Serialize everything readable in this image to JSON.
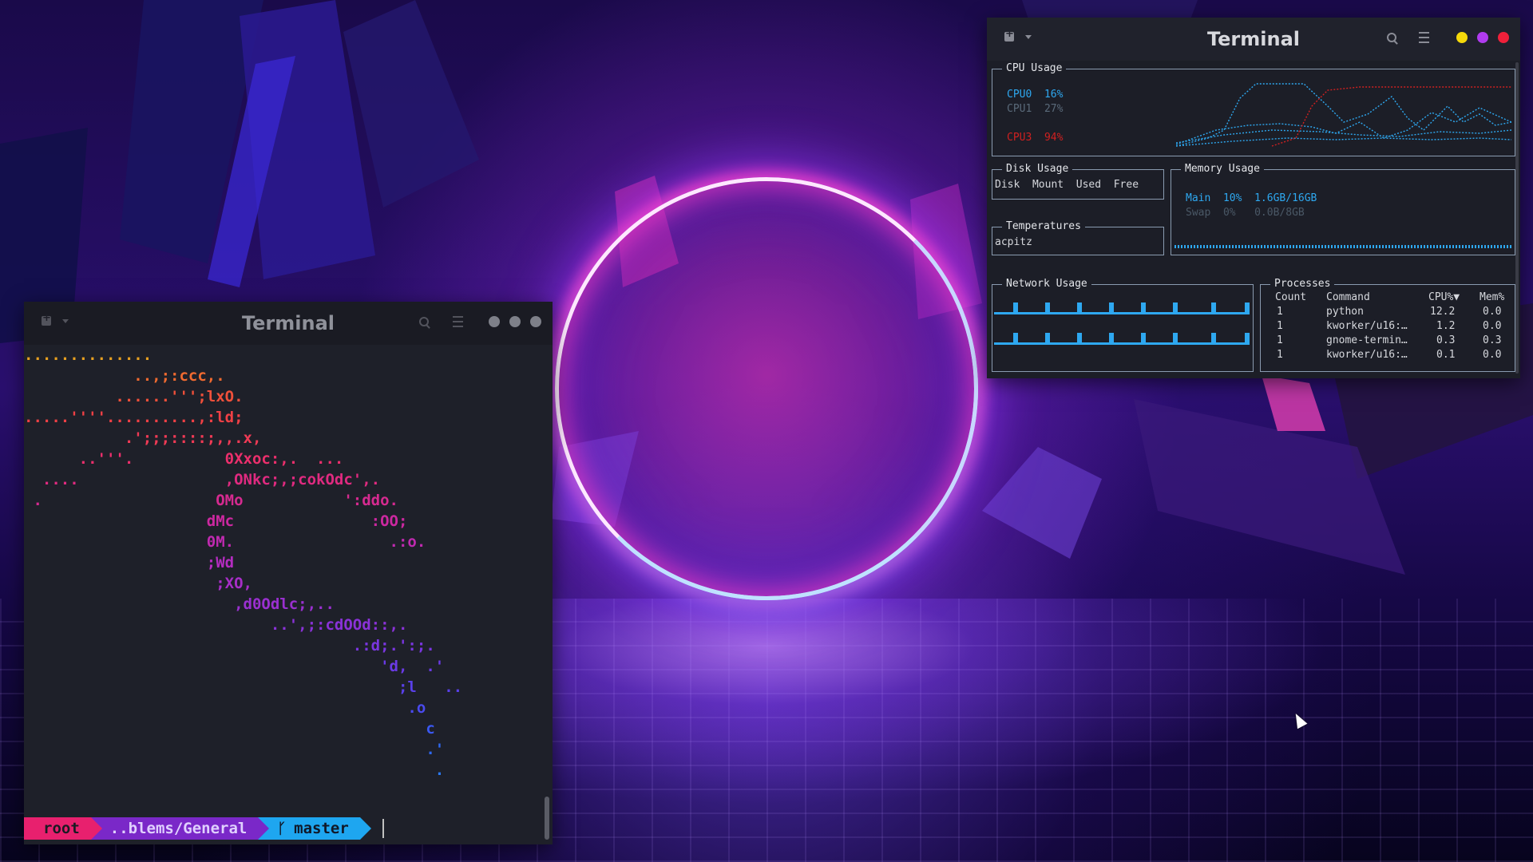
{
  "colors": {
    "accent_blue": "#2ea8f0",
    "alert_red": "#d02020",
    "prompt_pink": "#e8206e",
    "prompt_purple": "#7a28c8",
    "dot_yellow": "#f5d90a",
    "dot_purple": "#b03bf0",
    "dot_red": "#f0203a"
  },
  "left_terminal": {
    "title": "Terminal",
    "art_lines": [
      {
        "text": "..............",
        "color": "#e8a020"
      },
      {
        "text": "            ..,;:ccc,.",
        "color": "#f06a30"
      },
      {
        "text": "          ......''';lxO.",
        "color": "#f0503a"
      },
      {
        "text": ".....''''..........,:ld;",
        "color": "#f04045"
      },
      {
        "text": "           .';;;::::;,,.x,",
        "color": "#f03a55"
      },
      {
        "text": "      ..'''.          0Xxoc:,.  ...",
        "color": "#ec2f6c"
      },
      {
        "text": "  ....                ,ONkc;,;cokOdc',.",
        "color": "#e02a80"
      },
      {
        "text": " .                   OMo           ':ddo.",
        "color": "#d62a90"
      },
      {
        "text": "                    dMc               :OO;",
        "color": "#cc28a0"
      },
      {
        "text": "                    0M.                 .:o.",
        "color": "#c02ab0"
      },
      {
        "text": "                    ;Wd",
        "color": "#b42cc0"
      },
      {
        "text": "                     ;XO,",
        "color": "#a82ec8"
      },
      {
        "text": "                       ,d0Odlc;,..",
        "color": "#9a30d0"
      },
      {
        "text": "                           ..',;:cdOOd::,.",
        "color": "#8a32d8"
      },
      {
        "text": "                                    .:d;.':;.",
        "color": "#7a36e0"
      },
      {
        "text": "                                       'd,  .'",
        "color": "#6a3ae6"
      },
      {
        "text": "                                         ;l   ..",
        "color": "#5a40ea"
      },
      {
        "text": "                                          .o",
        "color": "#4a4aee"
      },
      {
        "text": "                                            c",
        "color": "#3a58f0"
      },
      {
        "text": "                                            .'",
        "color": "#2e68f0"
      },
      {
        "text": "                                             .",
        "color": "#2a78f0"
      }
    ],
    "prompt": {
      "user": "root",
      "path": "..blems/General",
      "git_icon": "git-branch-icon",
      "branch": "master"
    }
  },
  "right_terminal": {
    "title": "Terminal",
    "cpu": {
      "title": "CPU Usage",
      "rows": [
        {
          "label": "CPU0",
          "value": "16%"
        },
        {
          "label": "CPU1",
          "value": "27%"
        },
        {
          "label": "CPU3",
          "value": "94%"
        }
      ]
    },
    "disk": {
      "title": "Disk Usage",
      "headers": [
        "Disk",
        "Mount",
        "Used",
        "Free"
      ]
    },
    "temperatures": {
      "title": "Temperatures",
      "sensor": "acpitz"
    },
    "memory": {
      "title": "Memory Usage",
      "rows": [
        {
          "label": "Main",
          "percent": "10%",
          "amount": "1.6GB/16GB"
        },
        {
          "label": "Swap",
          "percent": "0%",
          "amount": "0.0B/8GB"
        }
      ]
    },
    "network": {
      "title": "Network Usage"
    },
    "processes": {
      "title": "Processes",
      "headers": [
        "Count",
        "Command",
        "CPU%▼",
        "Mem%"
      ],
      "rows": [
        {
          "count": "1",
          "command": "python",
          "cpu": "12.2",
          "mem": "0.0"
        },
        {
          "count": "1",
          "command": "kworker/u16:…",
          "cpu": "1.2",
          "mem": "0.0"
        },
        {
          "count": "1",
          "command": "gnome-termin…",
          "cpu": "0.3",
          "mem": "0.3"
        },
        {
          "count": "1",
          "command": "kworker/u16:…",
          "cpu": "0.1",
          "mem": "0.0"
        }
      ]
    }
  }
}
